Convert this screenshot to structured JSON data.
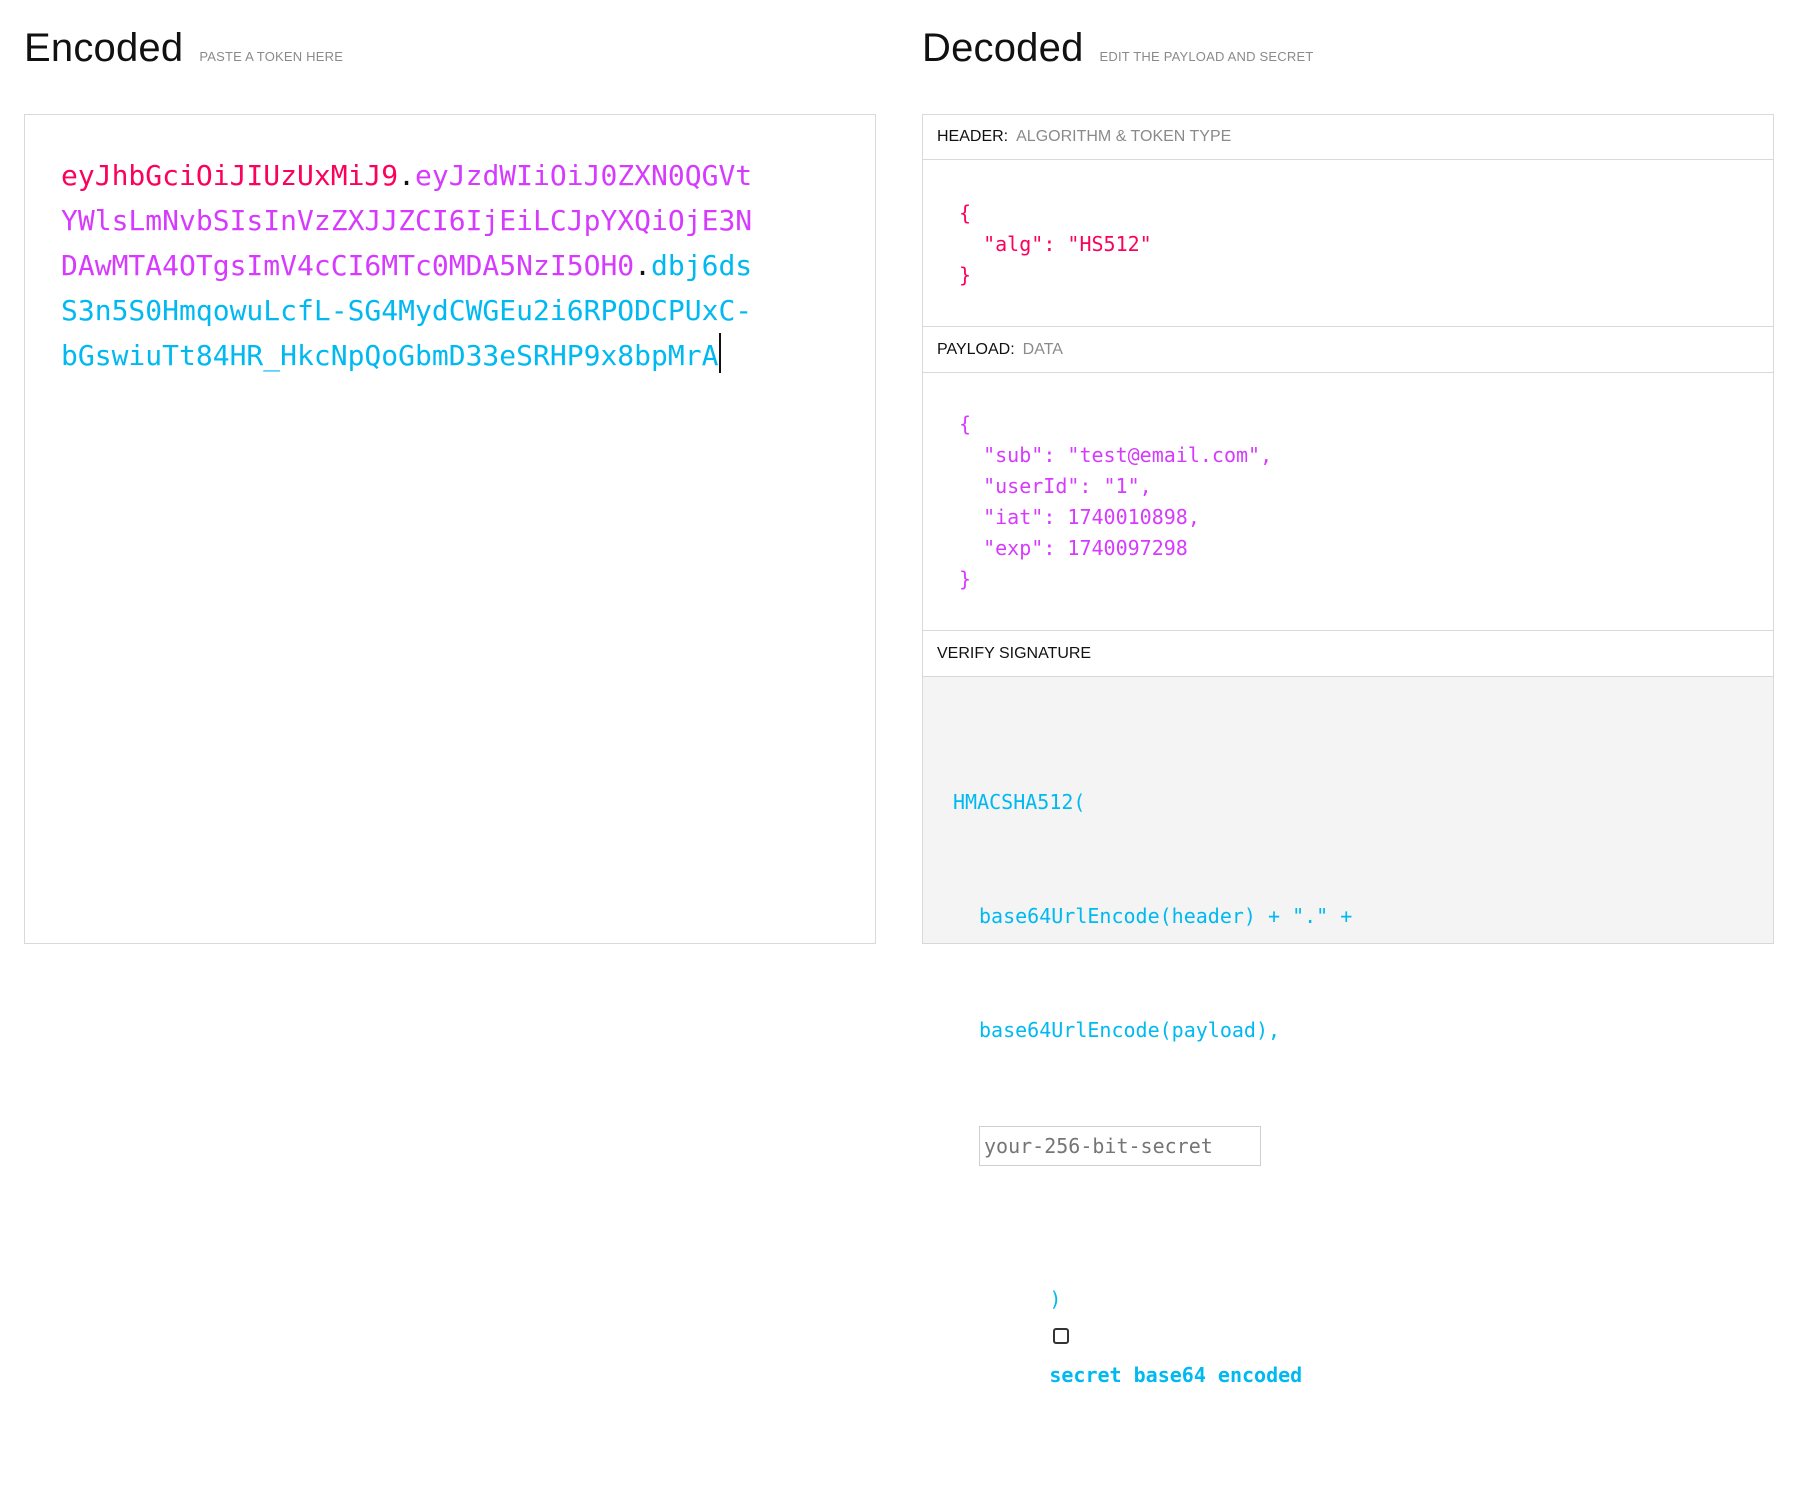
{
  "encoded": {
    "title": "Encoded",
    "subtitle": "PASTE A TOKEN HERE",
    "token": {
      "header": "eyJhbGciOiJIUzUxMiJ9",
      "payload": "eyJzdWIiOiJ0ZXN0QGVtYWlsLmNvbSIsInVzZXJJZCI6IjEiLCJpYXQiOjE3NDAwMTA4OTgsImV4cCI6MTc0MDA5NzI5OH0",
      "signature": "dbj6dsS3n5S0HmqowuLcfL-SG4MydCWGEu2i6RPODCPUxC-bGswiuTt84HR_HkcNpQoGbmD33eSRHP9x8bpMrA",
      "dot": "."
    }
  },
  "decoded": {
    "title": "Decoded",
    "subtitle": "EDIT THE PAYLOAD AND SECRET",
    "header": {
      "label": "HEADER:",
      "hint": "ALGORITHM & TOKEN TYPE",
      "open": "{",
      "close": "}",
      "alg_key": "\"alg\"",
      "alg_value": "\"HS512\""
    },
    "payload": {
      "label": "PAYLOAD:",
      "hint": "DATA",
      "open": "{",
      "close": "}",
      "sub_key": "\"sub\"",
      "sub_value": "\"test@email.com\"",
      "userId_key": "\"userId\"",
      "userId_value": "\"1\"",
      "iat_key": "\"iat\"",
      "iat_value": "1740010898",
      "exp_key": "\"exp\"",
      "exp_value": "1740097298"
    },
    "verify": {
      "label": "VERIFY SIGNATURE",
      "fn_open": "HMACSHA512(",
      "line1": "base64UrlEncode(header) + \".\" +",
      "line2": "base64UrlEncode(payload),",
      "secret_placeholder": "your-256-bit-secret",
      "close": ")",
      "checkbox_label": "secret base64 encoded"
    }
  },
  "colors": {
    "header": "#fb015b",
    "payload": "#d63aff",
    "signature": "#00b9f1"
  }
}
